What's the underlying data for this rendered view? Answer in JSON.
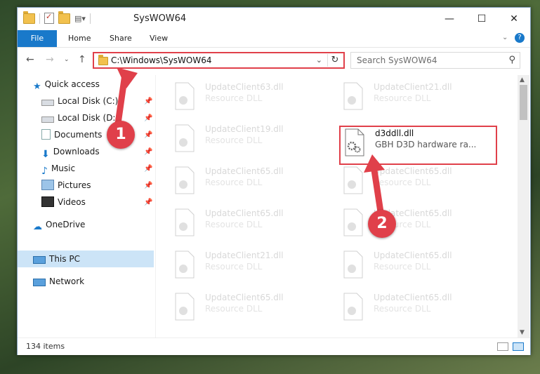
{
  "window": {
    "title": "SysWOW64",
    "controls": {
      "minimize": "—",
      "maximize": "☐",
      "close": "✕"
    }
  },
  "ribbon": {
    "tabs": [
      "File",
      "Home",
      "Share",
      "View"
    ]
  },
  "address_bar": {
    "path": "C:\\Windows\\SysWOW64",
    "refresh_icon": "↻"
  },
  "search": {
    "placeholder": "Search SysWOW64"
  },
  "sidebar": {
    "quick_access": "Quick access",
    "items": [
      {
        "label": "Local Disk (C:)",
        "icon": "drive-icon"
      },
      {
        "label": "Local Disk (D:)",
        "icon": "drive-icon"
      },
      {
        "label": "Documents",
        "icon": "documents-icon"
      },
      {
        "label": "Downloads",
        "icon": "downloads-icon"
      },
      {
        "label": "Music",
        "icon": "music-icon"
      },
      {
        "label": "Pictures",
        "icon": "pictures-icon"
      },
      {
        "label": "Videos",
        "icon": "videos-icon"
      }
    ],
    "onedrive": "OneDrive",
    "this_pc": "This PC",
    "network": "Network"
  },
  "files": [
    {
      "name": "UpdateClient63.dll",
      "desc": "Resource DLL"
    },
    {
      "name": "UpdateClient21.dll",
      "desc": "Resource DLL"
    },
    {
      "name": "UpdateClient19.dll",
      "desc": "Resource DLL"
    },
    {
      "name": "d3ddll.dll",
      "desc": "GBH D3D hardware ra..."
    },
    {
      "name": "UpdateClient65.dll",
      "desc": "Resource DLL"
    },
    {
      "name": "UpdateClient65.dll",
      "desc": "Resource DLL"
    },
    {
      "name": "UpdateClient65.dll",
      "desc": "Resource DLL"
    },
    {
      "name": "UpdateClient65.dll",
      "desc": "Resource DLL"
    },
    {
      "name": "UpdateClient21.dll",
      "desc": "Resource DLL"
    },
    {
      "name": "UpdateClient65.dll",
      "desc": "Resource DLL"
    },
    {
      "name": "UpdateClient65.dll",
      "desc": "Resource DLL"
    },
    {
      "name": "UpdateClient65.dll",
      "desc": "Resource DLL"
    }
  ],
  "status": {
    "item_count": "134 items"
  },
  "annotations": {
    "step1": "1",
    "step2": "2",
    "color": "#e0404a"
  }
}
